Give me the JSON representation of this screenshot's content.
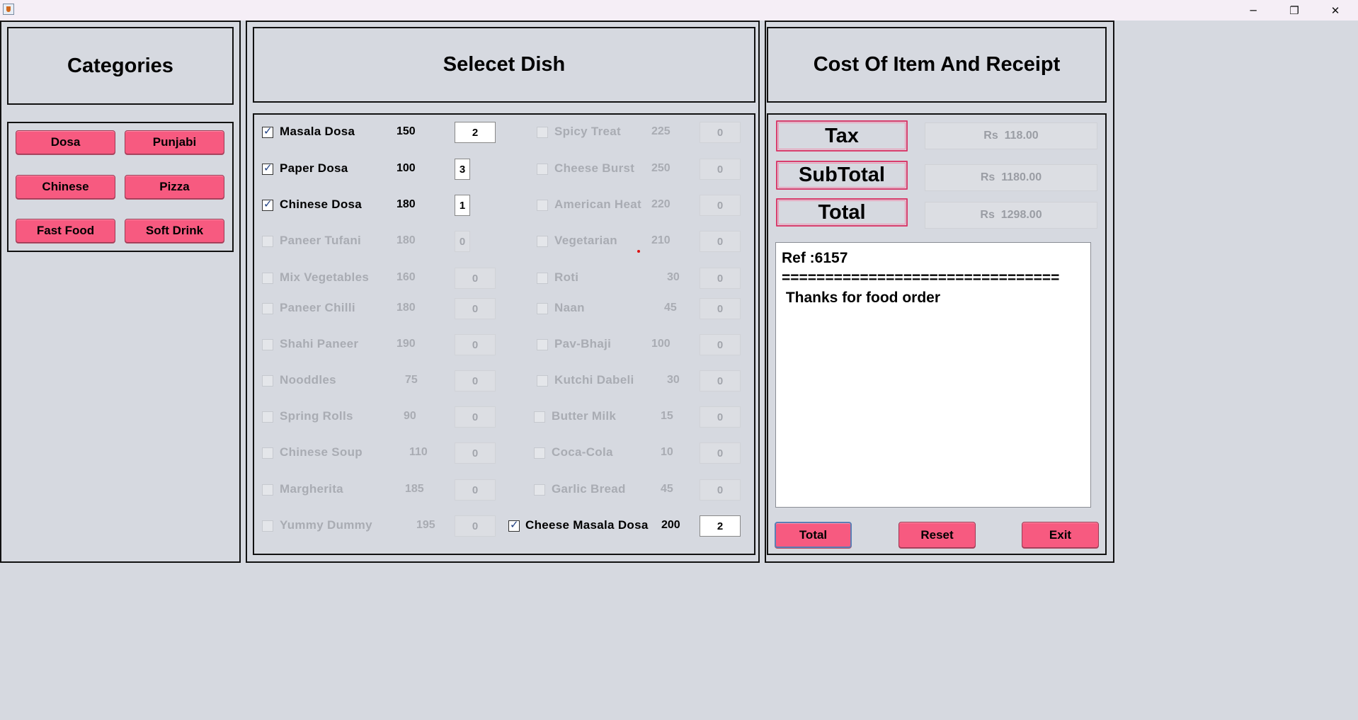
{
  "window": {
    "minimize_glyph": "─",
    "restore_glyph": "❐",
    "close_glyph": "✕"
  },
  "categories": {
    "heading": "Categories",
    "buttons": [
      "Dosa",
      "Punjabi",
      "Chinese",
      "Pizza",
      "Fast Food",
      "Soft Drink"
    ]
  },
  "dishes": {
    "heading": "Selecet Dish",
    "left": [
      {
        "name": "Masala Dosa",
        "price": "150",
        "qty": "2",
        "checked": true
      },
      {
        "name": "Paper Dosa",
        "price": "100",
        "qty": "3",
        "checked": true
      },
      {
        "name": "Chinese Dosa",
        "price": "180",
        "qty": "1",
        "checked": true
      },
      {
        "name": "Paneer Tufani",
        "price": "180",
        "qty": "0",
        "checked": false
      },
      {
        "name": "Mix Vegetables",
        "price": "160",
        "qty": "0",
        "checked": false
      },
      {
        "name": "Paneer Chilli",
        "price": "180",
        "qty": "0",
        "checked": false
      },
      {
        "name": "Shahi Paneer",
        "price": "190",
        "qty": "0",
        "checked": false
      },
      {
        "name": "Nooddles",
        "price": "75",
        "qty": "0",
        "checked": false
      },
      {
        "name": "Spring Rolls",
        "price": "90",
        "qty": "0",
        "checked": false
      },
      {
        "name": "Chinese Soup",
        "price": "110",
        "qty": "0",
        "checked": false
      },
      {
        "name": "Margherita",
        "price": "185",
        "qty": "0",
        "checked": false
      },
      {
        "name": "Yummy Dummy",
        "price": "195",
        "qty": "0",
        "checked": false
      }
    ],
    "right": [
      {
        "name": "Spicy Treat",
        "price": "225",
        "qty": "0",
        "checked": false
      },
      {
        "name": "Cheese Burst",
        "price": "250",
        "qty": "0",
        "checked": false
      },
      {
        "name": "American Heat",
        "price": "220",
        "qty": "0",
        "checked": false
      },
      {
        "name": "Vegetarian",
        "price": "210",
        "qty": "0",
        "checked": false
      },
      {
        "name": "Roti",
        "price": "30",
        "qty": "0",
        "checked": false
      },
      {
        "name": "Naan",
        "price": "45",
        "qty": "0",
        "checked": false
      },
      {
        "name": "Pav-Bhaji",
        "price": "100",
        "qty": "0",
        "checked": false
      },
      {
        "name": "Kutchi Dabeli",
        "price": "30",
        "qty": "0",
        "checked": false
      },
      {
        "name": "Butter Milk",
        "price": "15",
        "qty": "0",
        "checked": false
      },
      {
        "name": "Coca-Cola",
        "price": "10",
        "qty": "0",
        "checked": false
      },
      {
        "name": "Garlic Bread",
        "price": "45",
        "qty": "0",
        "checked": false
      },
      {
        "name": "Cheese Masala Dosa",
        "price": "200",
        "qty": "2",
        "checked": true
      }
    ]
  },
  "cost": {
    "heading": "Cost Of Item And Receipt",
    "tax_label": "Tax",
    "tax_value": "Rs  118.00",
    "subtotal_label": "SubTotal",
    "subtotal_value": "Rs  1180.00",
    "total_label": "Total",
    "total_value": "Rs  1298.00"
  },
  "receipt": {
    "ref_line": "Ref :6157",
    "separator": "================================",
    "message": " Thanks for food order"
  },
  "actions": {
    "total": "Total",
    "reset": "Reset",
    "exit": "Exit"
  },
  "colors": {
    "button_pink": "#f75a80",
    "window_bg": "#d6d9e0"
  }
}
